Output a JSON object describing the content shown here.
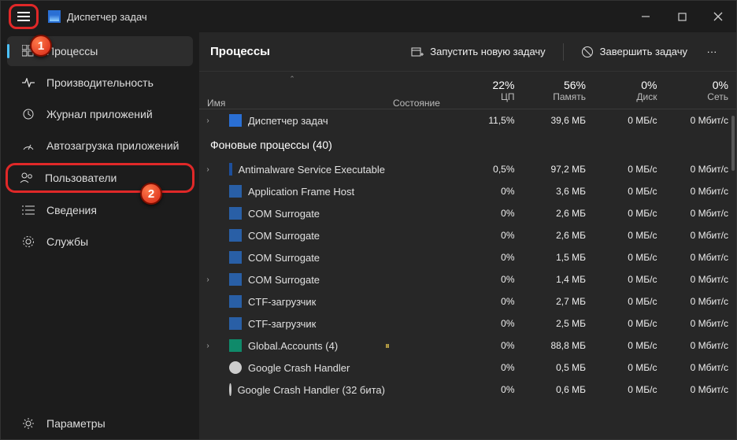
{
  "title": "Диспетчер задач",
  "heading": "Процессы",
  "toolbar": {
    "run_task": "Запустить новую задачу",
    "end_task": "Завершить задачу"
  },
  "sidebar": {
    "items": [
      {
        "label": "Процессы"
      },
      {
        "label": "Производительность"
      },
      {
        "label": "Журнал приложений"
      },
      {
        "label": "Автозагрузка приложений"
      },
      {
        "label": "Пользователи"
      },
      {
        "label": "Сведения"
      },
      {
        "label": "Службы"
      }
    ],
    "settings": "Параметры"
  },
  "columns": {
    "name": "Имя",
    "state": "Состояние",
    "cpu": {
      "pct": "22%",
      "label": "ЦП"
    },
    "mem": {
      "pct": "56%",
      "label": "Память"
    },
    "disk": {
      "pct": "0%",
      "label": "Диск"
    },
    "net": {
      "pct": "0%",
      "label": "Сеть"
    }
  },
  "group_header": "Фоновые процессы (40)",
  "rows": [
    {
      "exp": "›",
      "icon": "tm",
      "name": "Диспетчер задач",
      "state": "",
      "cpu": "11,5%",
      "mem": "39,6 МБ",
      "disk": "0 МБ/с",
      "net": "0 Мбит/с"
    },
    {
      "exp": "›",
      "icon": "exe",
      "name": "Antimalware Service Executable",
      "state": "",
      "cpu": "0,5%",
      "mem": "97,2 МБ",
      "disk": "0 МБ/с",
      "net": "0 Мбит/с"
    },
    {
      "exp": "",
      "icon": "win",
      "name": "Application Frame Host",
      "state": "",
      "cpu": "0%",
      "mem": "3,6 МБ",
      "disk": "0 МБ/с",
      "net": "0 Мбит/с"
    },
    {
      "exp": "",
      "icon": "win",
      "name": "COM Surrogate",
      "state": "",
      "cpu": "0%",
      "mem": "2,6 МБ",
      "disk": "0 МБ/с",
      "net": "0 Мбит/с"
    },
    {
      "exp": "",
      "icon": "win",
      "name": "COM Surrogate",
      "state": "",
      "cpu": "0%",
      "mem": "2,6 МБ",
      "disk": "0 МБ/с",
      "net": "0 Мбит/с"
    },
    {
      "exp": "",
      "icon": "win",
      "name": "COM Surrogate",
      "state": "",
      "cpu": "0%",
      "mem": "1,5 МБ",
      "disk": "0 МБ/с",
      "net": "0 Мбит/с"
    },
    {
      "exp": "›",
      "icon": "win",
      "name": "COM Surrogate",
      "state": "",
      "cpu": "0%",
      "mem": "1,4 МБ",
      "disk": "0 МБ/с",
      "net": "0 Мбит/с"
    },
    {
      "exp": "",
      "icon": "win",
      "name": "CTF-загрузчик",
      "state": "",
      "cpu": "0%",
      "mem": "2,7 МБ",
      "disk": "0 МБ/с",
      "net": "0 Мбит/с"
    },
    {
      "exp": "",
      "icon": "win",
      "name": "CTF-загрузчик",
      "state": "",
      "cpu": "0%",
      "mem": "2,5 МБ",
      "disk": "0 МБ/с",
      "net": "0 Мбит/с"
    },
    {
      "exp": "›",
      "icon": "grp",
      "name": "Global.Accounts (4)",
      "state": "⏸",
      "cpu": "0%",
      "mem": "88,8 МБ",
      "disk": "0 МБ/с",
      "net": "0 Мбит/с"
    },
    {
      "exp": "",
      "icon": "chrome",
      "name": "Google Crash Handler",
      "state": "",
      "cpu": "0%",
      "mem": "0,5 МБ",
      "disk": "0 МБ/с",
      "net": "0 Мбит/с"
    },
    {
      "exp": "",
      "icon": "chrome",
      "name": "Google Crash Handler (32 бита)",
      "state": "",
      "cpu": "0%",
      "mem": "0,6 МБ",
      "disk": "0 МБ/с",
      "net": "0 Мбит/с"
    }
  ],
  "annotations": {
    "badge1": "1",
    "badge2": "2"
  }
}
